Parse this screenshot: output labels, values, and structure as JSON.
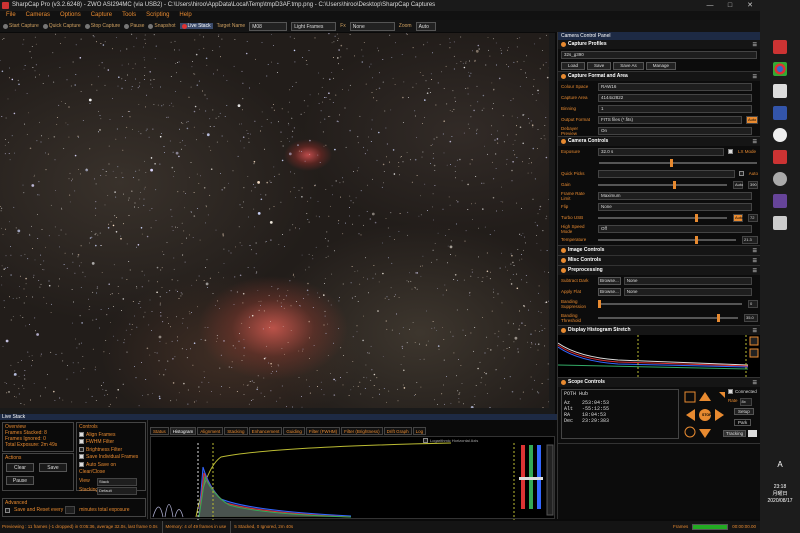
{
  "window": {
    "title": "SharpCap Pro (v3.2.6248) - ZWO ASI294MC (via USB2) - C:\\Users\\hiroo\\AppData\\Local\\Temp\\tmpD3AF.tmp.png - C:\\Users\\hiroo\\Desktop\\SharpCap Captures"
  },
  "menu": [
    "File",
    "Cameras",
    "Options",
    "Capture",
    "Tools",
    "Scripting",
    "Help"
  ],
  "toolbar": {
    "start_capture": "Start Capture",
    "quick_capture": "Quick Capture",
    "stop_capture": "Stop Capture",
    "pause": "Pause",
    "snapshot": "Snapshot",
    "live_stack": "Live Stack",
    "target_name_label": "Target Name",
    "target_name_value": "M08",
    "frame_type": "Light Frames",
    "fx_label": "Fx",
    "fx_value": "None",
    "zoom_label": "Zoom",
    "zoom_value": "Auto"
  },
  "panel": {
    "title": "Camera Control Panel",
    "capture_profiles": {
      "header": "Capture Profiles",
      "profile": "32s_g390",
      "buttons": [
        "Load",
        "Save",
        "Save As",
        "Manage"
      ]
    },
    "capture_format": {
      "header": "Capture Format and Area",
      "rows": [
        {
          "label": "Colour Space",
          "value": "RAW16"
        },
        {
          "label": "Capture Area",
          "value": "4144x2822"
        },
        {
          "label": "Binning",
          "value": "1"
        },
        {
          "label": "Output Format",
          "value": "FITS files (*.fits)"
        },
        {
          "label": "Debayer Preview",
          "value": "On"
        }
      ],
      "auto": "Auto"
    },
    "camera_controls": {
      "header": "Camera Controls",
      "exposure_label": "Exposure",
      "exposure_value": "32.0 s",
      "lx_mode": "LX Mode",
      "quick_picks_label": "Quick Picks",
      "auto_label": "Auto",
      "gain_label": "Gain",
      "gain_value": "390",
      "frame_rate_label": "Frame Rate Limit",
      "frame_rate_value": "Maximum",
      "flip_label": "Flip",
      "flip_value": "None",
      "turbo_usb_label": "Turbo USB",
      "turbo_usb_value": "72",
      "high_speed_label": "High Speed Mode",
      "high_speed_value": "Off",
      "temperature_label": "Temperature",
      "temperature_value": "21.3"
    },
    "image_controls": "Image Controls",
    "misc_controls": "Misc Controls",
    "preprocessing": {
      "header": "Preprocessing",
      "subtract_dark_label": "Subtract Dark",
      "apply_flat_label": "Apply Flat",
      "browse": "Browse...",
      "none": "None",
      "banding_suppression": "Banding Suppression",
      "banding_threshold": "Banding Threshold",
      "banding_value": "0",
      "threshold_value": "35.0"
    },
    "histogram": {
      "header": "Display Histogram Stretch"
    },
    "scope": {
      "header": "Scope Controls",
      "device": "POTH Hub",
      "connected": "Connected",
      "rate_label": "Rate",
      "rate_value": "8x",
      "setup": "Setup",
      "park": "Park",
      "tracking": "Tracking",
      "stop": "STOP",
      "coords": [
        {
          "label": "Az",
          "value": "253:04:53"
        },
        {
          "label": "Alt",
          "value": "-55:12:55"
        },
        {
          "label": "RA",
          "value": "18:04:53"
        },
        {
          "label": "Dec",
          "value": "23:29:383"
        }
      ]
    }
  },
  "live_stack": {
    "title": "Live Stack",
    "overview_label": "Overview",
    "frames_stacked": "Frames Stacked: 8",
    "frames_ignored": "Frames Ignored: 0",
    "total_exposure": "Total Exposure: 2m 49s",
    "actions_label": "Actions",
    "clear": "Clear",
    "save": "Save",
    "pause": "Pause",
    "controls_label": "Controls",
    "checks": [
      {
        "label": "Align Frames",
        "on": true
      },
      {
        "label": "FWHM Filter",
        "on": true
      },
      {
        "label": "Brightness Filter",
        "on": false
      },
      {
        "label": "Save Individual Frames",
        "on": true
      },
      {
        "label": "Auto Save on Clear/Close",
        "on": true
      }
    ],
    "view_label": "View",
    "view_value": "Stack",
    "stacking_label": "Stacking",
    "stacking_value": "Default",
    "advanced_label": "Advanced",
    "save_reset": "Save and Reset every",
    "minutes": "minutes total exposure",
    "tabs": [
      "Status",
      "Histogram",
      "Alignment",
      "Stacking",
      "Enhancement",
      "Guiding",
      "Filter (FWHM)",
      "Filter (Brightness)",
      "Drift Graph",
      "Log"
    ],
    "histo_opts": "Logarithmic Horizontal Axis",
    "frames_summary": "5 Stacked, 0 Ignored, 2m 40s"
  },
  "status": {
    "previewing": "Previewing : 11 frames (-1 dropped) in 0:05:36, average 32.0s, last frame 0.0s",
    "memory": "Memory: 4 of 49 frames in use",
    "frames": "Frames",
    "time": "00:00:00.00"
  },
  "taskbar": {
    "clock": "23:18",
    "day": "月曜日",
    "date": "2020/08/17",
    "ime": "A"
  },
  "colors": {
    "accent": "#e88a30",
    "panel_header": "#1d2a44"
  }
}
